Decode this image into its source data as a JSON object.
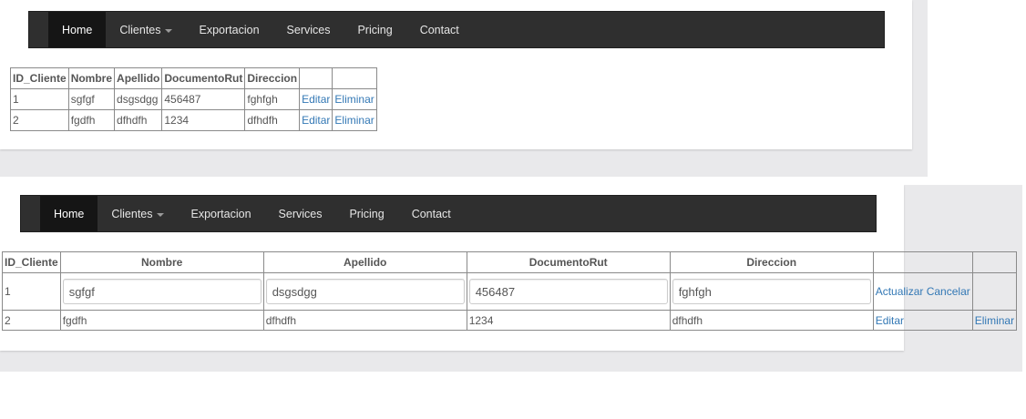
{
  "nav": {
    "items": [
      {
        "label": "Home",
        "active": true
      },
      {
        "label": "Clientes",
        "dropdown": true
      },
      {
        "label": "Exportacion"
      },
      {
        "label": "Services"
      },
      {
        "label": "Pricing"
      },
      {
        "label": "Contact"
      }
    ]
  },
  "table1": {
    "headers": [
      "ID_Cliente",
      "Nombre",
      "Apellido",
      "DocumentoRut",
      "Direccion",
      "",
      ""
    ],
    "rows": [
      {
        "id": "1",
        "nombre": "sgfgf",
        "apellido": "dsgsdgg",
        "documento": "456487",
        "direccion": "fghfgh",
        "edit": "Editar",
        "delete": "Eliminar"
      },
      {
        "id": "2",
        "nombre": "fgdfh",
        "apellido": "dfhdfh",
        "documento": "1234",
        "direccion": "dfhdfh",
        "edit": "Editar",
        "delete": "Eliminar"
      }
    ]
  },
  "table2": {
    "headers": [
      "ID_Cliente",
      "Nombre",
      "Apellido",
      "DocumentoRut",
      "Direccion",
      "",
      ""
    ],
    "edit_row": {
      "id": "1",
      "nombre": "sgfgf",
      "apellido": "dsgsdgg",
      "documento": "456487",
      "direccion": "fghfgh",
      "update": "Actualizar",
      "cancel": "Cancelar"
    },
    "row": {
      "id": "2",
      "nombre": "fgdfh",
      "apellido": "dfhdfh",
      "documento": "1234",
      "direccion": "dfhdfh",
      "edit": "Editar",
      "delete": "Eliminar"
    }
  },
  "colors": {
    "navbar": "#2f2f2f",
    "nav_active": "#151515",
    "link": "#3378b5",
    "page_bg": "#e9e9eb"
  }
}
